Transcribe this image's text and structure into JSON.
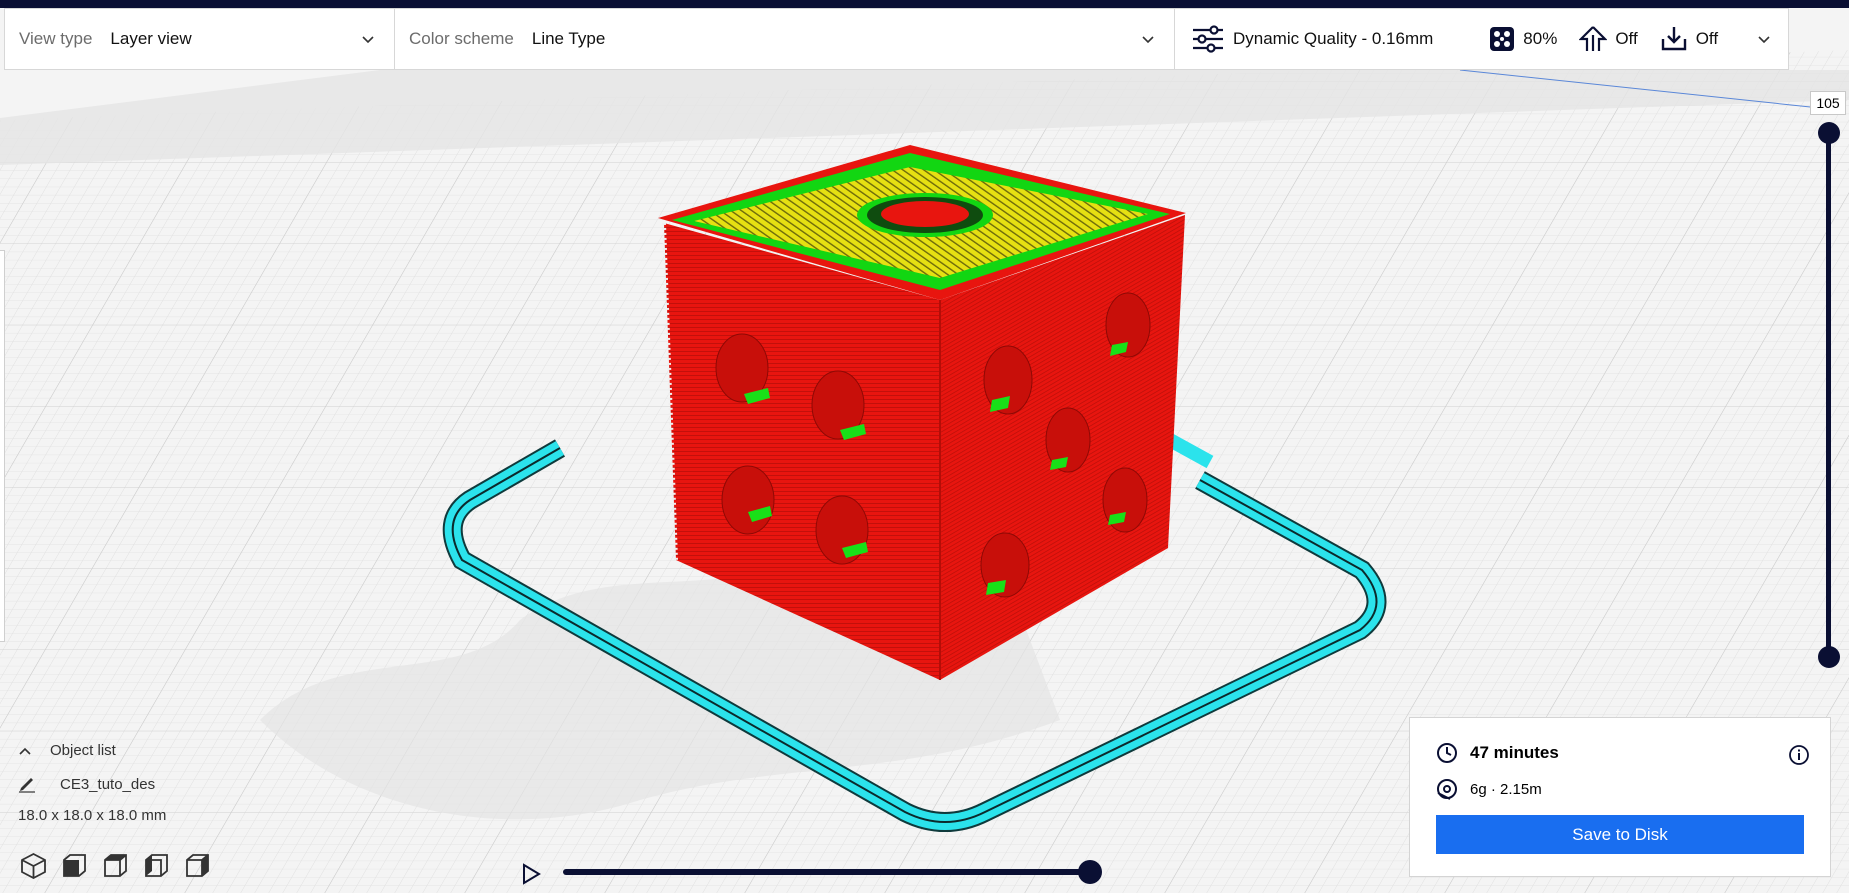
{
  "view_bar": {
    "view_type": {
      "label": "View type",
      "value": "Layer view"
    },
    "color_scheme": {
      "label": "Color scheme",
      "value": "Line Type"
    },
    "quality": {
      "profile": "Dynamic Quality - 0.16mm",
      "infill": "80%",
      "support": "Off",
      "adhesion": "Off"
    }
  },
  "layer_slider": {
    "current_layer": "105",
    "fill": 1.0
  },
  "path_slider": {
    "fill": 1.0
  },
  "object_panel": {
    "toggle_label": "Object list",
    "object_name": "CE3_tuto_des",
    "dimensions": "18.0 x 18.0 x 18.0 mm"
  },
  "print_panel": {
    "time": "47 minutes",
    "material": "6g · 2.15m",
    "save_label": "Save to Disk"
  },
  "colors": {
    "wall_outer": "#e8150f",
    "wall_inner": "#13e613",
    "top_bottom": "#e8e313",
    "skirt": "#29e6ee",
    "accent": "#196ef0",
    "dark": "#0a0f33"
  },
  "icons": [
    "chevron-down-icon",
    "quality-settings-icon",
    "infill-icon",
    "support-icon",
    "adhesion-icon",
    "play-icon",
    "pencil-icon",
    "clock-icon",
    "spool-icon",
    "info-icon",
    "3d-view-icon",
    "front-view-icon",
    "top-view-icon",
    "left-view-icon",
    "right-view-icon"
  ]
}
